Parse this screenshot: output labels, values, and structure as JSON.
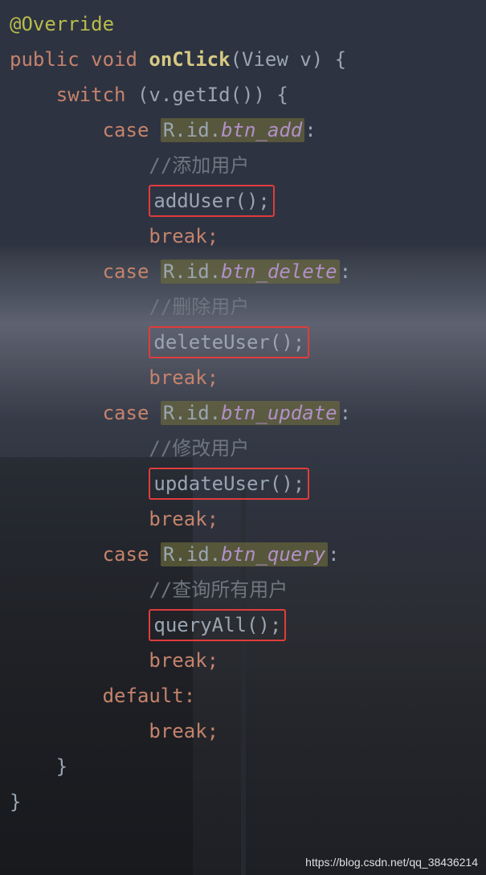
{
  "code": {
    "annotation": "@Override",
    "modifiers": "public void",
    "method_name": "onClick",
    "param_type": "View",
    "param_name": "v",
    "switch_expr_obj": "v",
    "switch_expr_call": "getId",
    "R": "R",
    "id": "id",
    "cases": [
      {
        "field": "btn_add",
        "comment": "//添加用户",
        "call": "addUser();",
        "break": "break;"
      },
      {
        "field": "btn_delete",
        "comment": "//删除用户",
        "call": "deleteUser();",
        "break": "break;"
      },
      {
        "field": "btn_update",
        "comment": "//修改用户",
        "call": "updateUser();",
        "break": "break;"
      },
      {
        "field": "btn_query",
        "comment": "//查询所有用户",
        "call": "queryAll();",
        "break": "break;"
      }
    ],
    "default_label": "default:",
    "default_break": "break;",
    "case_kw": "case",
    "switch_kw": "switch",
    "break_kw": "break"
  },
  "watermark": "https://blog.csdn.net/qq_38436214"
}
